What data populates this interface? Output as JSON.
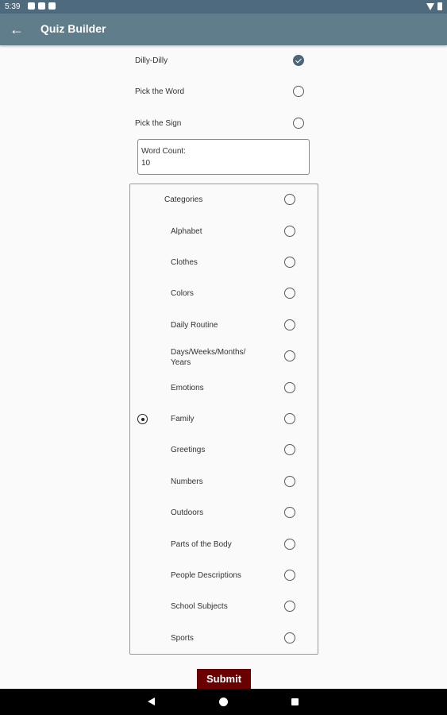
{
  "status_bar": {
    "time": "5:39"
  },
  "app_bar": {
    "title": "Quiz Builder",
    "back_icon": "arrow-back-icon"
  },
  "quiz_types": [
    {
      "label": "Dilly-Dilly",
      "selected": true
    },
    {
      "label": "Pick the Word",
      "selected": false
    },
    {
      "label": "Pick the Sign",
      "selected": false
    }
  ],
  "word_count": {
    "label": "Word Count:",
    "value": "10"
  },
  "categories": {
    "header": "Categories",
    "items": [
      {
        "label": "Alphabet"
      },
      {
        "label": "Clothes"
      },
      {
        "label": "Colors"
      },
      {
        "label": "Daily Routine"
      },
      {
        "label": "Days/Weeks/Months/ Years"
      },
      {
        "label": "Emotions"
      },
      {
        "label": "Family"
      },
      {
        "label": "Greetings"
      },
      {
        "label": "Numbers"
      },
      {
        "label": "Outdoors"
      },
      {
        "label": "Parts of the Body"
      },
      {
        "label": "People Descriptions"
      },
      {
        "label": "School Subjects"
      },
      {
        "label": "Sports"
      }
    ]
  },
  "submit": {
    "label": "Submit"
  },
  "colors": {
    "app_bar": "#607d8b",
    "status_bar": "#4e6b7e",
    "submit": "#6b0000",
    "checked": "#4b6678"
  }
}
